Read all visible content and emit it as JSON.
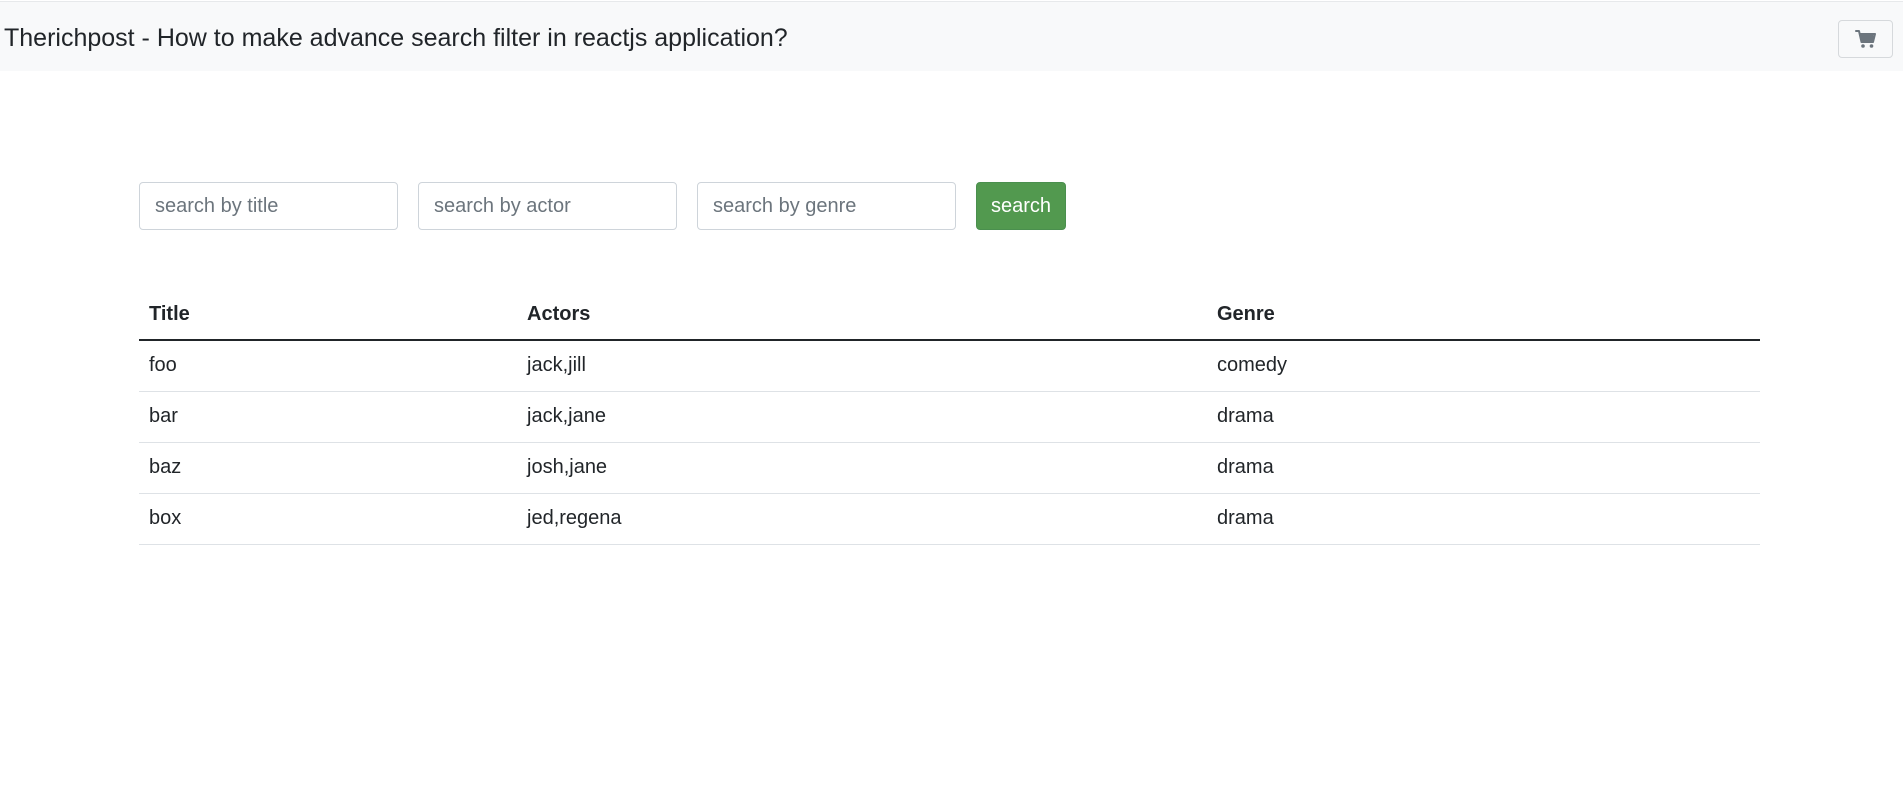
{
  "navbar": {
    "brand": "Therichpost - How to make advance search filter in reactjs application?",
    "cart_icon": "shopping-cart-icon"
  },
  "filters": {
    "title_placeholder": "search by title",
    "actor_placeholder": "search by actor",
    "genre_placeholder": "search by genre",
    "search_label": "search",
    "search_color": "#52994f"
  },
  "table": {
    "headers": [
      "Title",
      "Actors",
      "Genre"
    ],
    "rows": [
      [
        "foo",
        "jack,jill",
        "comedy"
      ],
      [
        "bar",
        "jack,jane",
        "drama"
      ],
      [
        "baz",
        "josh,jane",
        "drama"
      ],
      [
        "box",
        "jed,regena",
        "drama"
      ]
    ]
  }
}
